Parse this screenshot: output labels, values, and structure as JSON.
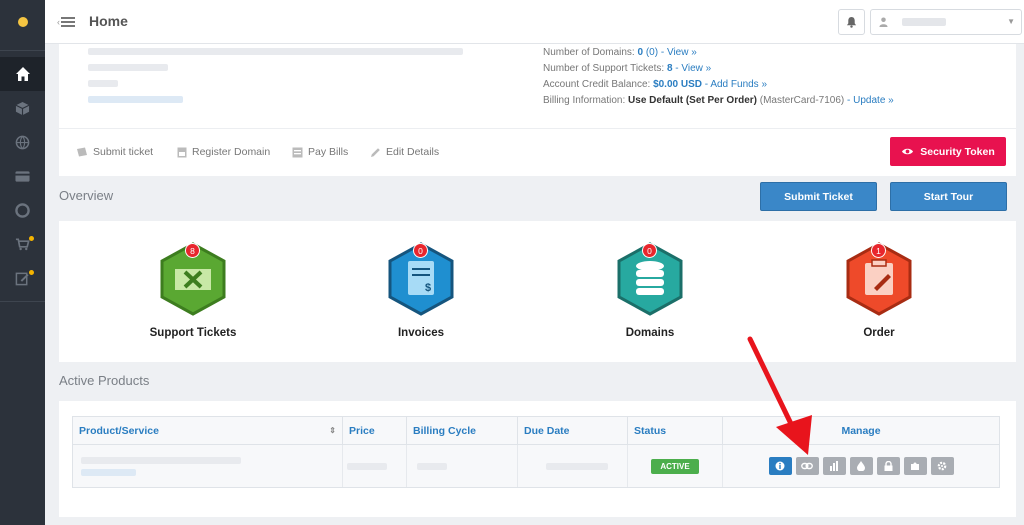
{
  "topbar": {
    "title": "Home"
  },
  "account": {
    "info": [
      {
        "label": "Number of Domains:",
        "value": "0",
        "extra": "(0)",
        "link": "- View »"
      },
      {
        "label": "Number of Support Tickets:",
        "value": "8",
        "extra": "",
        "link": "- View »"
      },
      {
        "label": "Account Credit Balance:",
        "value": "$0.00 USD",
        "extra": "",
        "link": "- Add Funds »"
      },
      {
        "label": "Billing Information:",
        "value": "Use Default (Set Per Order)",
        "extra": "(MasterCard-7106)",
        "link": "- Update »"
      }
    ],
    "actions": [
      "Submit ticket",
      "Register Domain",
      "Pay Bills",
      "Edit Details"
    ],
    "security_label": "Security Token"
  },
  "overview": {
    "title": "Overview",
    "submit_ticket_label": "Submit Ticket",
    "start_tour_label": "Start Tour",
    "tiles": [
      {
        "label": "Support Tickets",
        "count": "8",
        "color": "#5aa832"
      },
      {
        "label": "Invoices",
        "count": "0",
        "color": "#1f8fd0"
      },
      {
        "label": "Domains",
        "count": "0",
        "color": "#27a9a0"
      },
      {
        "label": "Order",
        "count": "1",
        "color": "#ee4a2a"
      }
    ]
  },
  "products": {
    "title": "Active Products",
    "columns": [
      "Product/Service",
      "Price",
      "Billing Cycle",
      "Due Date",
      "Status",
      "Manage"
    ],
    "status": "ACTIVE"
  },
  "colors": {
    "accent": "#3a87c8",
    "danger": "#e8124f",
    "success": "#4cae4c",
    "sidebar": "#2c323b"
  }
}
